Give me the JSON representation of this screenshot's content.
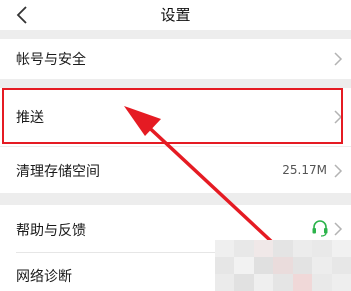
{
  "header": {
    "title": "设置"
  },
  "settings": {
    "account": {
      "label": "帐号与安全"
    },
    "push": {
      "label": "推送"
    },
    "storage": {
      "label": "清理存储空间",
      "value": "25.17M"
    },
    "help": {
      "label": "帮助与反馈"
    },
    "network": {
      "label": "网络诊断"
    }
  },
  "annotation": {
    "color": "#e51b23"
  },
  "icons": {
    "back": "chevron-left-icon",
    "chevron": "chevron-right-icon",
    "headset": "headset-icon"
  }
}
